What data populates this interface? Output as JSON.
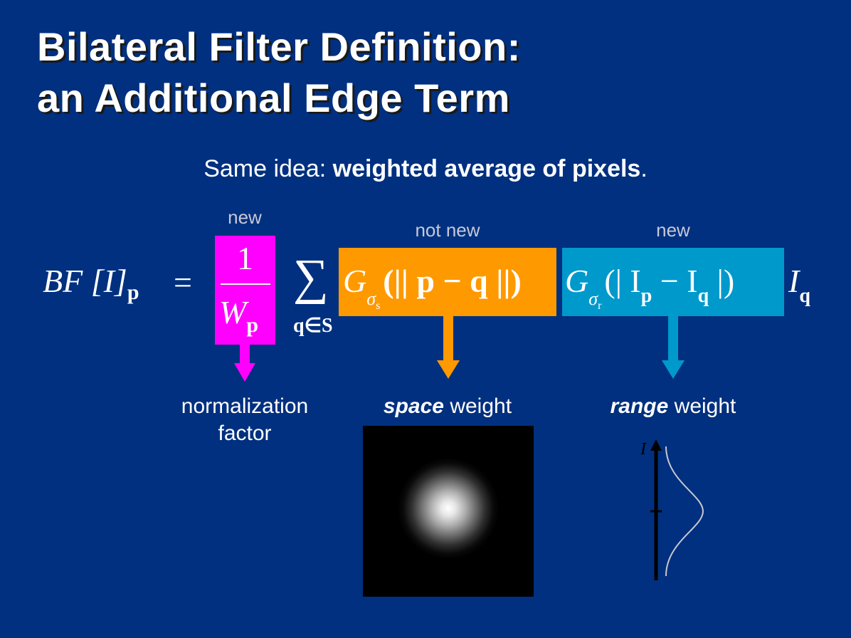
{
  "title_line1": "Bilateral Filter Definition:",
  "title_line2": "an Additional Edge Term",
  "subtitle": {
    "prefix": "Same idea: ",
    "bold": "weighted average of pixels",
    "suffix": "."
  },
  "tags": {
    "norm": "new",
    "space": "not new",
    "range": "new"
  },
  "equation": {
    "lhs": "BF [I]",
    "lhs_sub": "p",
    "equals": "=",
    "numerator": "1",
    "denominator": "W",
    "denominator_sub": "p",
    "sum_symbol": "∑",
    "sum_sub": "q∈S",
    "space_term": "G",
    "space_sigma": "σ",
    "space_sigma_sub": "s",
    "space_arg": "(|| p − q ||)",
    "range_term": "G",
    "range_sigma": "σ",
    "range_sigma_sub": "r",
    "range_arg_open": "(| I",
    "range_arg_p": "p",
    "range_arg_mid": " − I",
    "range_arg_q": "q",
    "range_arg_close": " |)",
    "tail": "I",
    "tail_sub": "q"
  },
  "labels": {
    "norm_line1": "normalization",
    "norm_line2": "factor",
    "space_bold": "space",
    "space_rest": " weight",
    "range_bold": "range",
    "range_rest": " weight",
    "axis_label": "I"
  },
  "colors": {
    "background": "#00307f",
    "norm_box": "#ff00ff",
    "space_box": "#ff9900",
    "range_box": "#0099cc"
  }
}
